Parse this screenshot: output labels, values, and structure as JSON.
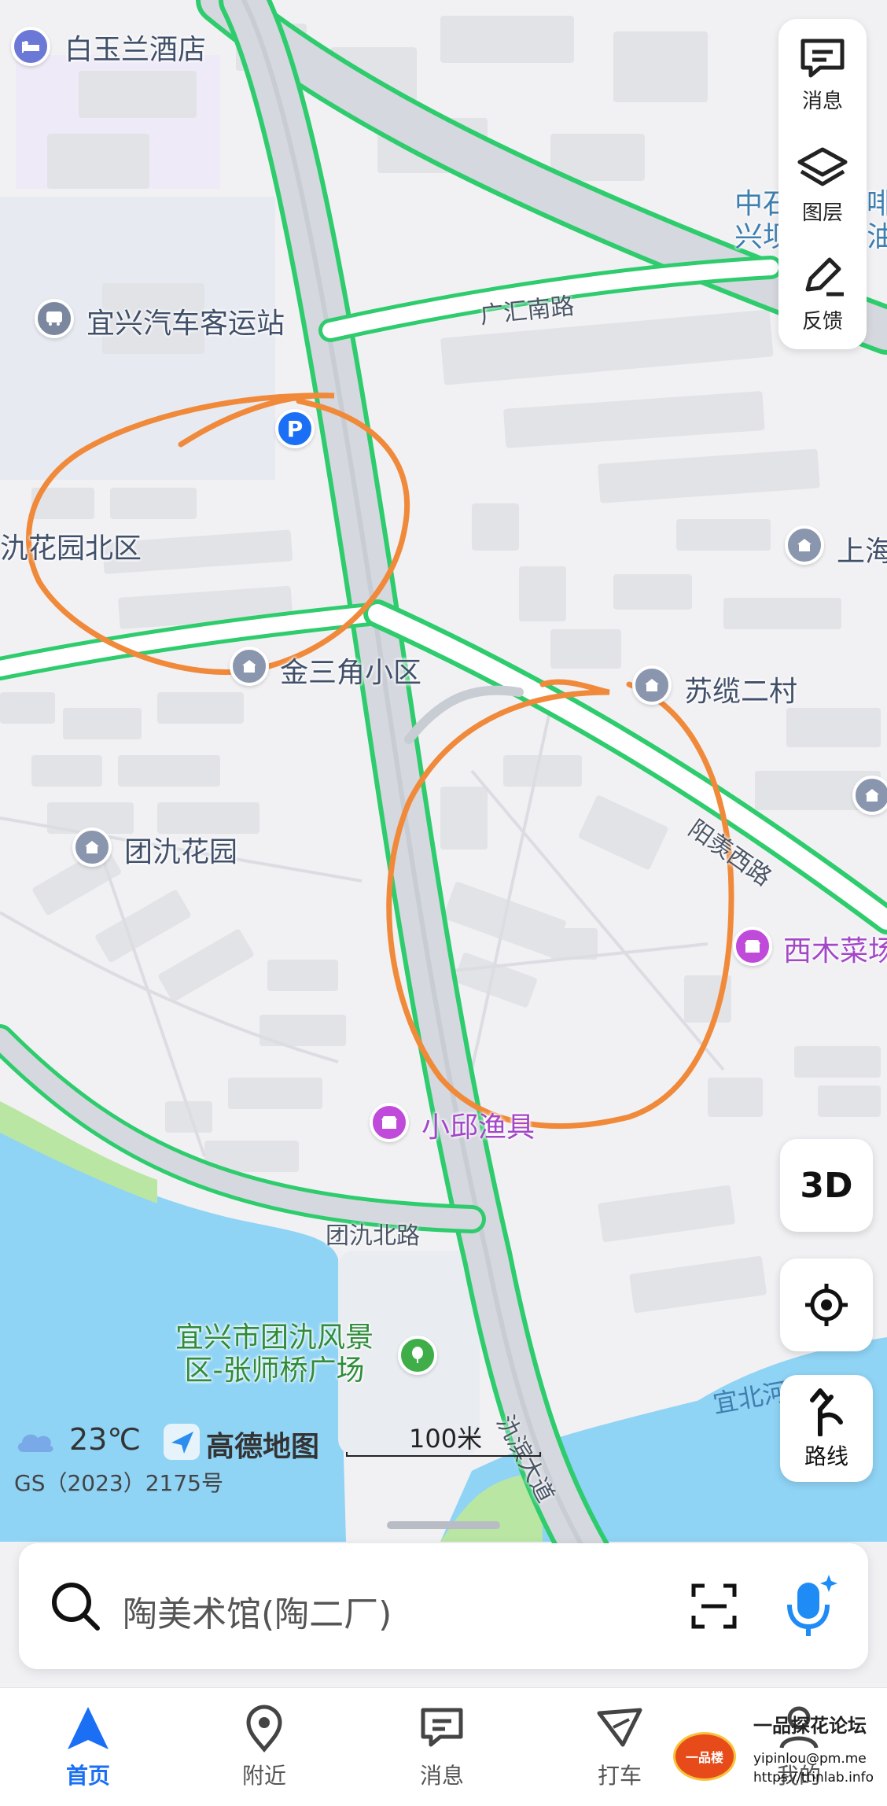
{
  "map": {
    "pois": {
      "hotel": "白玉兰酒店",
      "bus_station": "宜兴汽车客运站",
      "garden_north": "氿花园北区",
      "jinsanjiao": "金三角小区",
      "sulan": "苏缆二村",
      "shanghai": "上海",
      "tuanjiu_garden": "团氿花园",
      "ximucai": "西木菜场",
      "xiaoqiu": "小邱渔具",
      "park": "宜兴市团氿风景区-张师桥广场"
    },
    "roads": {
      "guanghui": "广汇南路",
      "yangxian": "阳羡西路",
      "tuanjiu_north": "团氿北路",
      "jiubin": "氿滨大道"
    },
    "edge_labels": {
      "top_right_a": "中石",
      "top_right_b": "兴坝",
      "top_right_c": "啡",
      "top_right_d": "油",
      "yibei": "宜北河"
    },
    "parking_glyph": "P"
  },
  "tools": {
    "messages": "消息",
    "layers": "图层",
    "feedback": "反馈",
    "three_d": "3D",
    "route": "路线"
  },
  "status": {
    "temperature": "23℃",
    "brand": "高德地图",
    "license": "GS（2023）2175号",
    "scale": "100米"
  },
  "search": {
    "placeholder": "陶美术馆(陶二厂)"
  },
  "nav": {
    "home": "首页",
    "nearby": "附近",
    "messages": "消息",
    "taxi": "打车",
    "mine": "我的"
  },
  "watermark": {
    "title": "一品探花论坛",
    "line1": "yipinlou@pm.me",
    "line2": "https://ttinlab.info",
    "badge": "一品楼"
  },
  "colors": {
    "road_outline": "#2fcc6e",
    "water": "#8fd3f5",
    "annotation": "#f08a3a",
    "accent": "#1a6ff5"
  }
}
